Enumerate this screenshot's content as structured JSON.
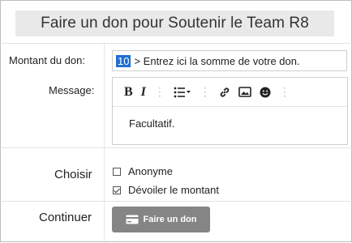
{
  "title": "Faire un don pour Soutenir le Team R8",
  "amount": {
    "label": "Montant du don:",
    "value": "10",
    "hint": "> Entrez ici la somme de votre don."
  },
  "message": {
    "label": "Message:",
    "toolbar": {
      "bold": "B",
      "italic": "I",
      "icons": [
        "bold-icon",
        "italic-icon",
        "list-icon",
        "link-icon",
        "image-icon",
        "emoji-icon",
        "more-icon"
      ]
    },
    "placeholder": "Facultatif."
  },
  "choose": {
    "label": "Choisir",
    "options": [
      {
        "label": "Anonyme",
        "checked": false
      },
      {
        "label": "Dévoiler le montant",
        "checked": true
      }
    ]
  },
  "continue": {
    "label": "Continuer",
    "button_label": "Faire un don",
    "button_color": "#858585"
  }
}
